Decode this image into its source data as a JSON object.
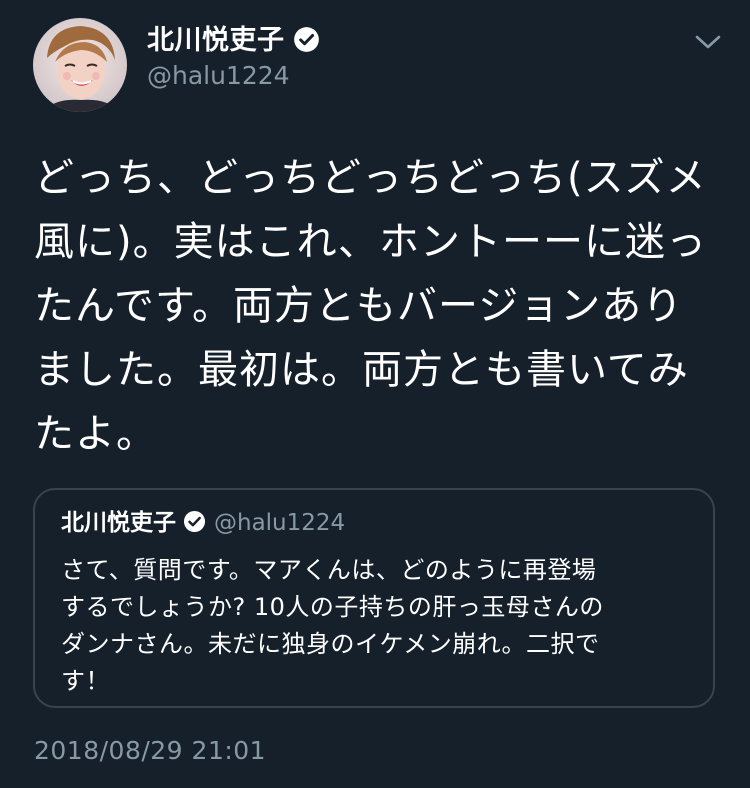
{
  "tweet": {
    "author": {
      "name": "北川悦吏子",
      "handle": "@halu1224",
      "verified": true
    },
    "text": "どっち、どっちどっちどっち(スズメ\n風に)。実はこれ、ホントーーに迷っ\nたんです。両方ともバージョンあり\nました。最初は。両方とも書いてみ\nたよ。",
    "timestamp": "2018/08/29 21:01"
  },
  "quoted_tweet": {
    "author": {
      "name": "北川悦吏子",
      "handle": "@halu1224",
      "verified": true
    },
    "text": "さて、質問です。マアくんは、どのように再登場\nするでしょうか? 10人の子持ちの肝っ玉母さんの\nダンナさん。未だに独身のイケメン崩れ。二択で\nす！"
  },
  "icons": {
    "verified": "verified-badge-icon",
    "menu": "chevron-down-icon"
  },
  "colors": {
    "background": "#15202b",
    "secondary_text": "#8899a6",
    "border": "#38444d"
  }
}
